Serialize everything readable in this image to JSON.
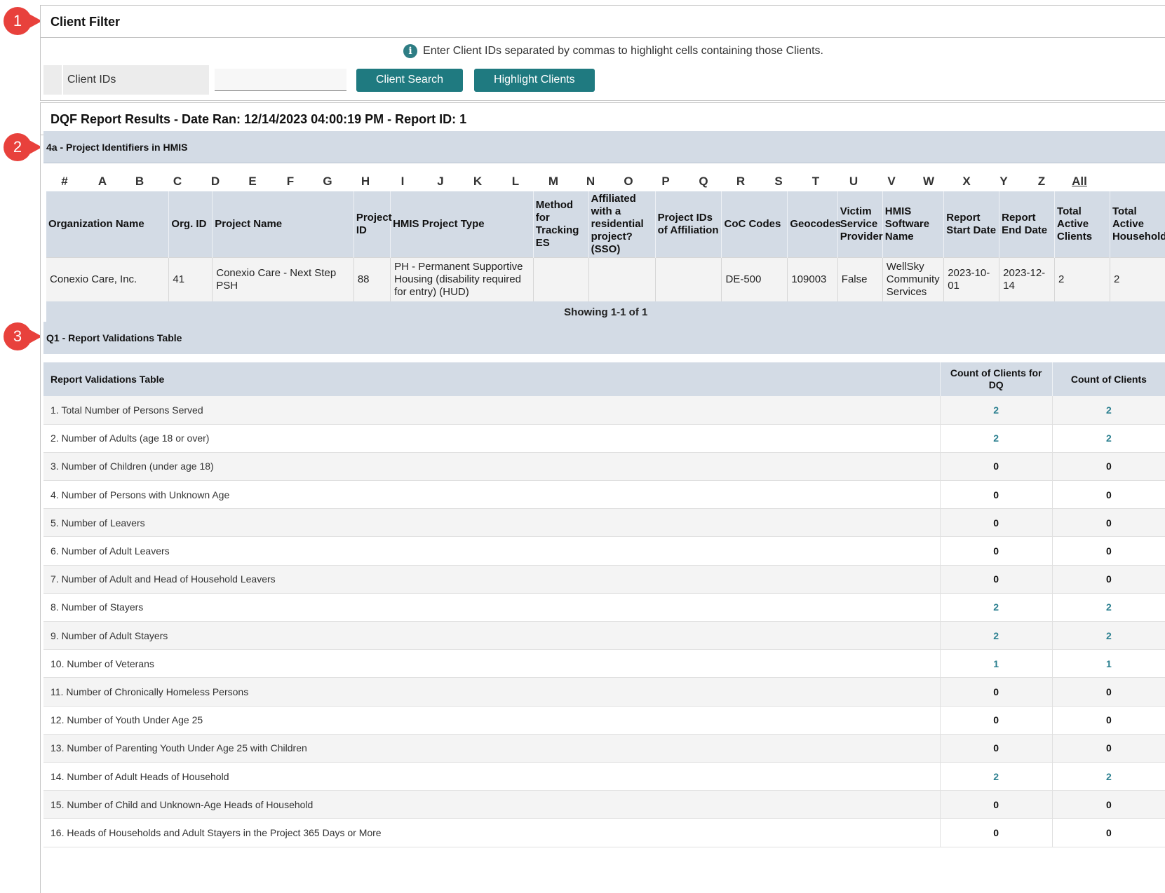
{
  "callouts": [
    "1",
    "2",
    "3"
  ],
  "client_filter": {
    "title": "Client Filter",
    "info_text": "Enter Client IDs separated by commas to highlight cells containing those Clients.",
    "info_icon": "info-icon",
    "label": "Client IDs",
    "input_value": "",
    "search_button": "Client Search",
    "highlight_button": "Highlight Clients"
  },
  "report": {
    "title": "DQF Report Results - Date Ran: 12/14/2023 04:00:19 PM - Report ID: 1"
  },
  "section_4a": {
    "title": "4a - Project Identifiers in HMIS",
    "alphabet": [
      "#",
      "A",
      "B",
      "C",
      "D",
      "E",
      "F",
      "G",
      "H",
      "I",
      "J",
      "K",
      "L",
      "M",
      "N",
      "O",
      "P",
      "Q",
      "R",
      "S",
      "T",
      "U",
      "V",
      "W",
      "X",
      "Y",
      "Z",
      "All"
    ],
    "columns": [
      "Organization Name",
      "Org. ID",
      "Project Name",
      "Project ID",
      "HMIS Project Type",
      "Method for Tracking ES",
      "Affiliated with a residential project? (SSO)",
      "Project IDs of Affiliation",
      "CoC Codes",
      "Geocodes",
      "Victim Service Provider",
      "HMIS Software Name",
      "Report Start Date",
      "Report End Date",
      "Total Active Clients",
      "Total Active Households"
    ],
    "rows": [
      [
        "Conexio Care, Inc.",
        "41",
        "Conexio Care - Next Step PSH",
        "88",
        "PH - Permanent Supportive Housing (disability required for entry) (HUD)",
        "",
        "",
        "",
        "DE-500",
        "109003",
        "False",
        "WellSky Community Services",
        "2023-10-01",
        "2023-12-14",
        "2",
        "2"
      ]
    ],
    "footer": "Showing 1-1 of 1"
  },
  "section_q1": {
    "title": "Q1 - Report Validations Table",
    "columns": [
      "Report Validations Table",
      "Count of Clients for DQ",
      "Count of Clients"
    ],
    "rows": [
      {
        "label": "1. Total Number of Persons Served",
        "dq": "2",
        "count": "2"
      },
      {
        "label": "2. Number of Adults (age 18 or over)",
        "dq": "2",
        "count": "2"
      },
      {
        "label": "3. Number of Children (under age 18)",
        "dq": "0",
        "count": "0"
      },
      {
        "label": "4. Number of Persons with Unknown Age",
        "dq": "0",
        "count": "0"
      },
      {
        "label": "5. Number of Leavers",
        "dq": "0",
        "count": "0"
      },
      {
        "label": "6. Number of Adult Leavers",
        "dq": "0",
        "count": "0"
      },
      {
        "label": "7. Number of Adult and Head of Household Leavers",
        "dq": "0",
        "count": "0"
      },
      {
        "label": "8. Number of Stayers",
        "dq": "2",
        "count": "2"
      },
      {
        "label": "9. Number of Adult Stayers",
        "dq": "2",
        "count": "2"
      },
      {
        "label": "10. Number of Veterans",
        "dq": "1",
        "count": "1"
      },
      {
        "label": "11. Number of Chronically Homeless Persons",
        "dq": "0",
        "count": "0"
      },
      {
        "label": "12. Number of Youth Under Age 25",
        "dq": "0",
        "count": "0"
      },
      {
        "label": "13. Number of Parenting Youth Under Age 25 with Children",
        "dq": "0",
        "count": "0"
      },
      {
        "label": "14. Number of Adult Heads of Household",
        "dq": "2",
        "count": "2"
      },
      {
        "label": "15. Number of Child and Unknown-Age Heads of Household",
        "dq": "0",
        "count": "0"
      },
      {
        "label": "16. Heads of Households and Adult Stayers in the Project 365 Days or More",
        "dq": "0",
        "count": "0"
      }
    ]
  },
  "colors": {
    "accent": "#1f7a80",
    "header_bg": "#d3dbe5",
    "callout": "#e8413c",
    "link_value": "#2a7f8f"
  }
}
